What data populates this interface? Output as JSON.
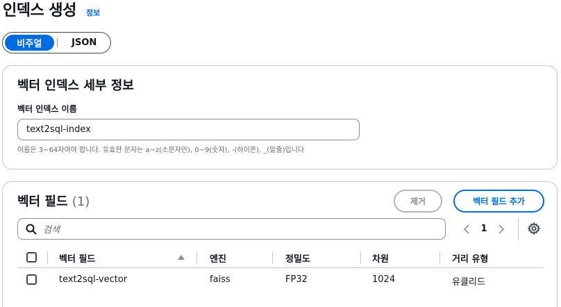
{
  "header": {
    "title": "인덱스 생성",
    "info_link": "정보"
  },
  "view_toggle": {
    "options": [
      "비주얼",
      "JSON"
    ],
    "selected": "비주얼"
  },
  "details_card": {
    "title": "벡터 인덱스 세부 정보",
    "name_label": "벡터 인덱스 이름",
    "name_value": "text2sql-index",
    "name_hint": "이름은 3~64자여야 합니다. 유효한 문자는 a~z(소문자만), 0~9(숫자), -(하이픈), _(밑줄)입니다"
  },
  "fields_card": {
    "title": "벡터 필드",
    "count": "(1)",
    "remove_button": "제거",
    "add_button": "벡터 필드 추가",
    "search_placeholder": "검색",
    "page_number": "1",
    "columns": [
      "벡터 필드",
      "엔진",
      "정밀도",
      "차원",
      "거리 유형"
    ],
    "rows": [
      {
        "field": "text2sql-vector",
        "engine": "faiss",
        "precision": "FP32",
        "dimension": "1024",
        "distance": "유클리드"
      }
    ]
  },
  "colors": {
    "accent": "#006ce0",
    "border": "#c6c6cd",
    "muted_text": "#656871"
  },
  "icons": [
    "search-icon",
    "chevron-left-icon",
    "chevron-right-icon",
    "gear-icon",
    "sort-up-icon"
  ]
}
